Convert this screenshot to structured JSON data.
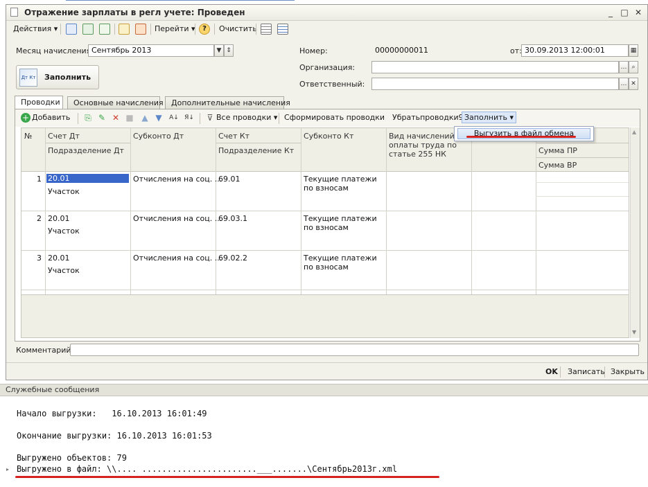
{
  "window": {
    "title": "Отражение зарплаты в регл учете: Проведен"
  },
  "toolbar": {
    "actions": "Действия",
    "goto": "Перейти",
    "clear": "Очистить"
  },
  "header": {
    "month_label": "Месяц начисления:",
    "month_value": "Сентябрь 2013",
    "number_label": "Номер:",
    "number_value": "00000000011",
    "from_label": "от:",
    "date_value": "30.09.2013 12:00:01",
    "org_label": "Организация:",
    "org_value": "",
    "resp_label": "Ответственный:",
    "resp_value": "",
    "fill_button": "Заполнить",
    "fill_icon_text": "Дт Кт"
  },
  "tabs": [
    "Проводки",
    "Основные начисления",
    "Дополнительные начисления"
  ],
  "panel_toolbar": {
    "add": "Добавить",
    "all_postings": "Все проводки",
    "form_postings": "Сформировать проводки",
    "remove_postings": "Убратьпроводки96",
    "fill": "Заполнить"
  },
  "menu": {
    "item": "Выгузить в файл обмена"
  },
  "grid": {
    "headers": {
      "num": "№",
      "debit": "Счет Дт",
      "debit_sub": "Подразделение Дт",
      "subconto_dt": "Субконто Дт",
      "credit": "Счет Кт",
      "credit_sub": "Подразделение Кт",
      "subconto_kt": "Субконто Кт",
      "accrual_type": "Вид начислений оплаты труда по статье 255 НК",
      "sum_pr": "Сумма ПР",
      "sum_vr": "Сумма ВР"
    },
    "rows": [
      {
        "n": "1",
        "debit": "20.01",
        "dept": "Участок",
        "subconto_dt": "Отчисления на соц. ...",
        "credit": "69.01",
        "subconto_kt": "Текущие платежи по взносам"
      },
      {
        "n": "2",
        "debit": "20.01",
        "dept": "Участок",
        "subconto_dt": "Отчисления на соц. ...",
        "credit": "69.03.1",
        "subconto_kt": "Текущие платежи по взносам"
      },
      {
        "n": "3",
        "debit": "20.01",
        "dept": "Участок",
        "subconto_dt": "Отчисления на соц. ...",
        "credit": "69.02.2",
        "subconto_kt": "Текущие платежи по взносам"
      }
    ]
  },
  "comment": {
    "label": "Комментарий:",
    "value": ""
  },
  "bottom": {
    "ok": "OK",
    "save": "Записать",
    "close": "Закрыть"
  },
  "messages": {
    "title": "Служебные сообщения",
    "lines": [
      "Начало выгрузки:   16.10.2013 16:01:49",
      "Окончание выгрузки: 16.10.2013 16:01:53",
      "Выгружено объектов: 79",
      "Выгружено в файл: \\\\.... .......................___.......\\Сентябрь2013г.xml"
    ]
  },
  "colors": {
    "accent": "#3966c9",
    "underline": "#d5221f"
  }
}
